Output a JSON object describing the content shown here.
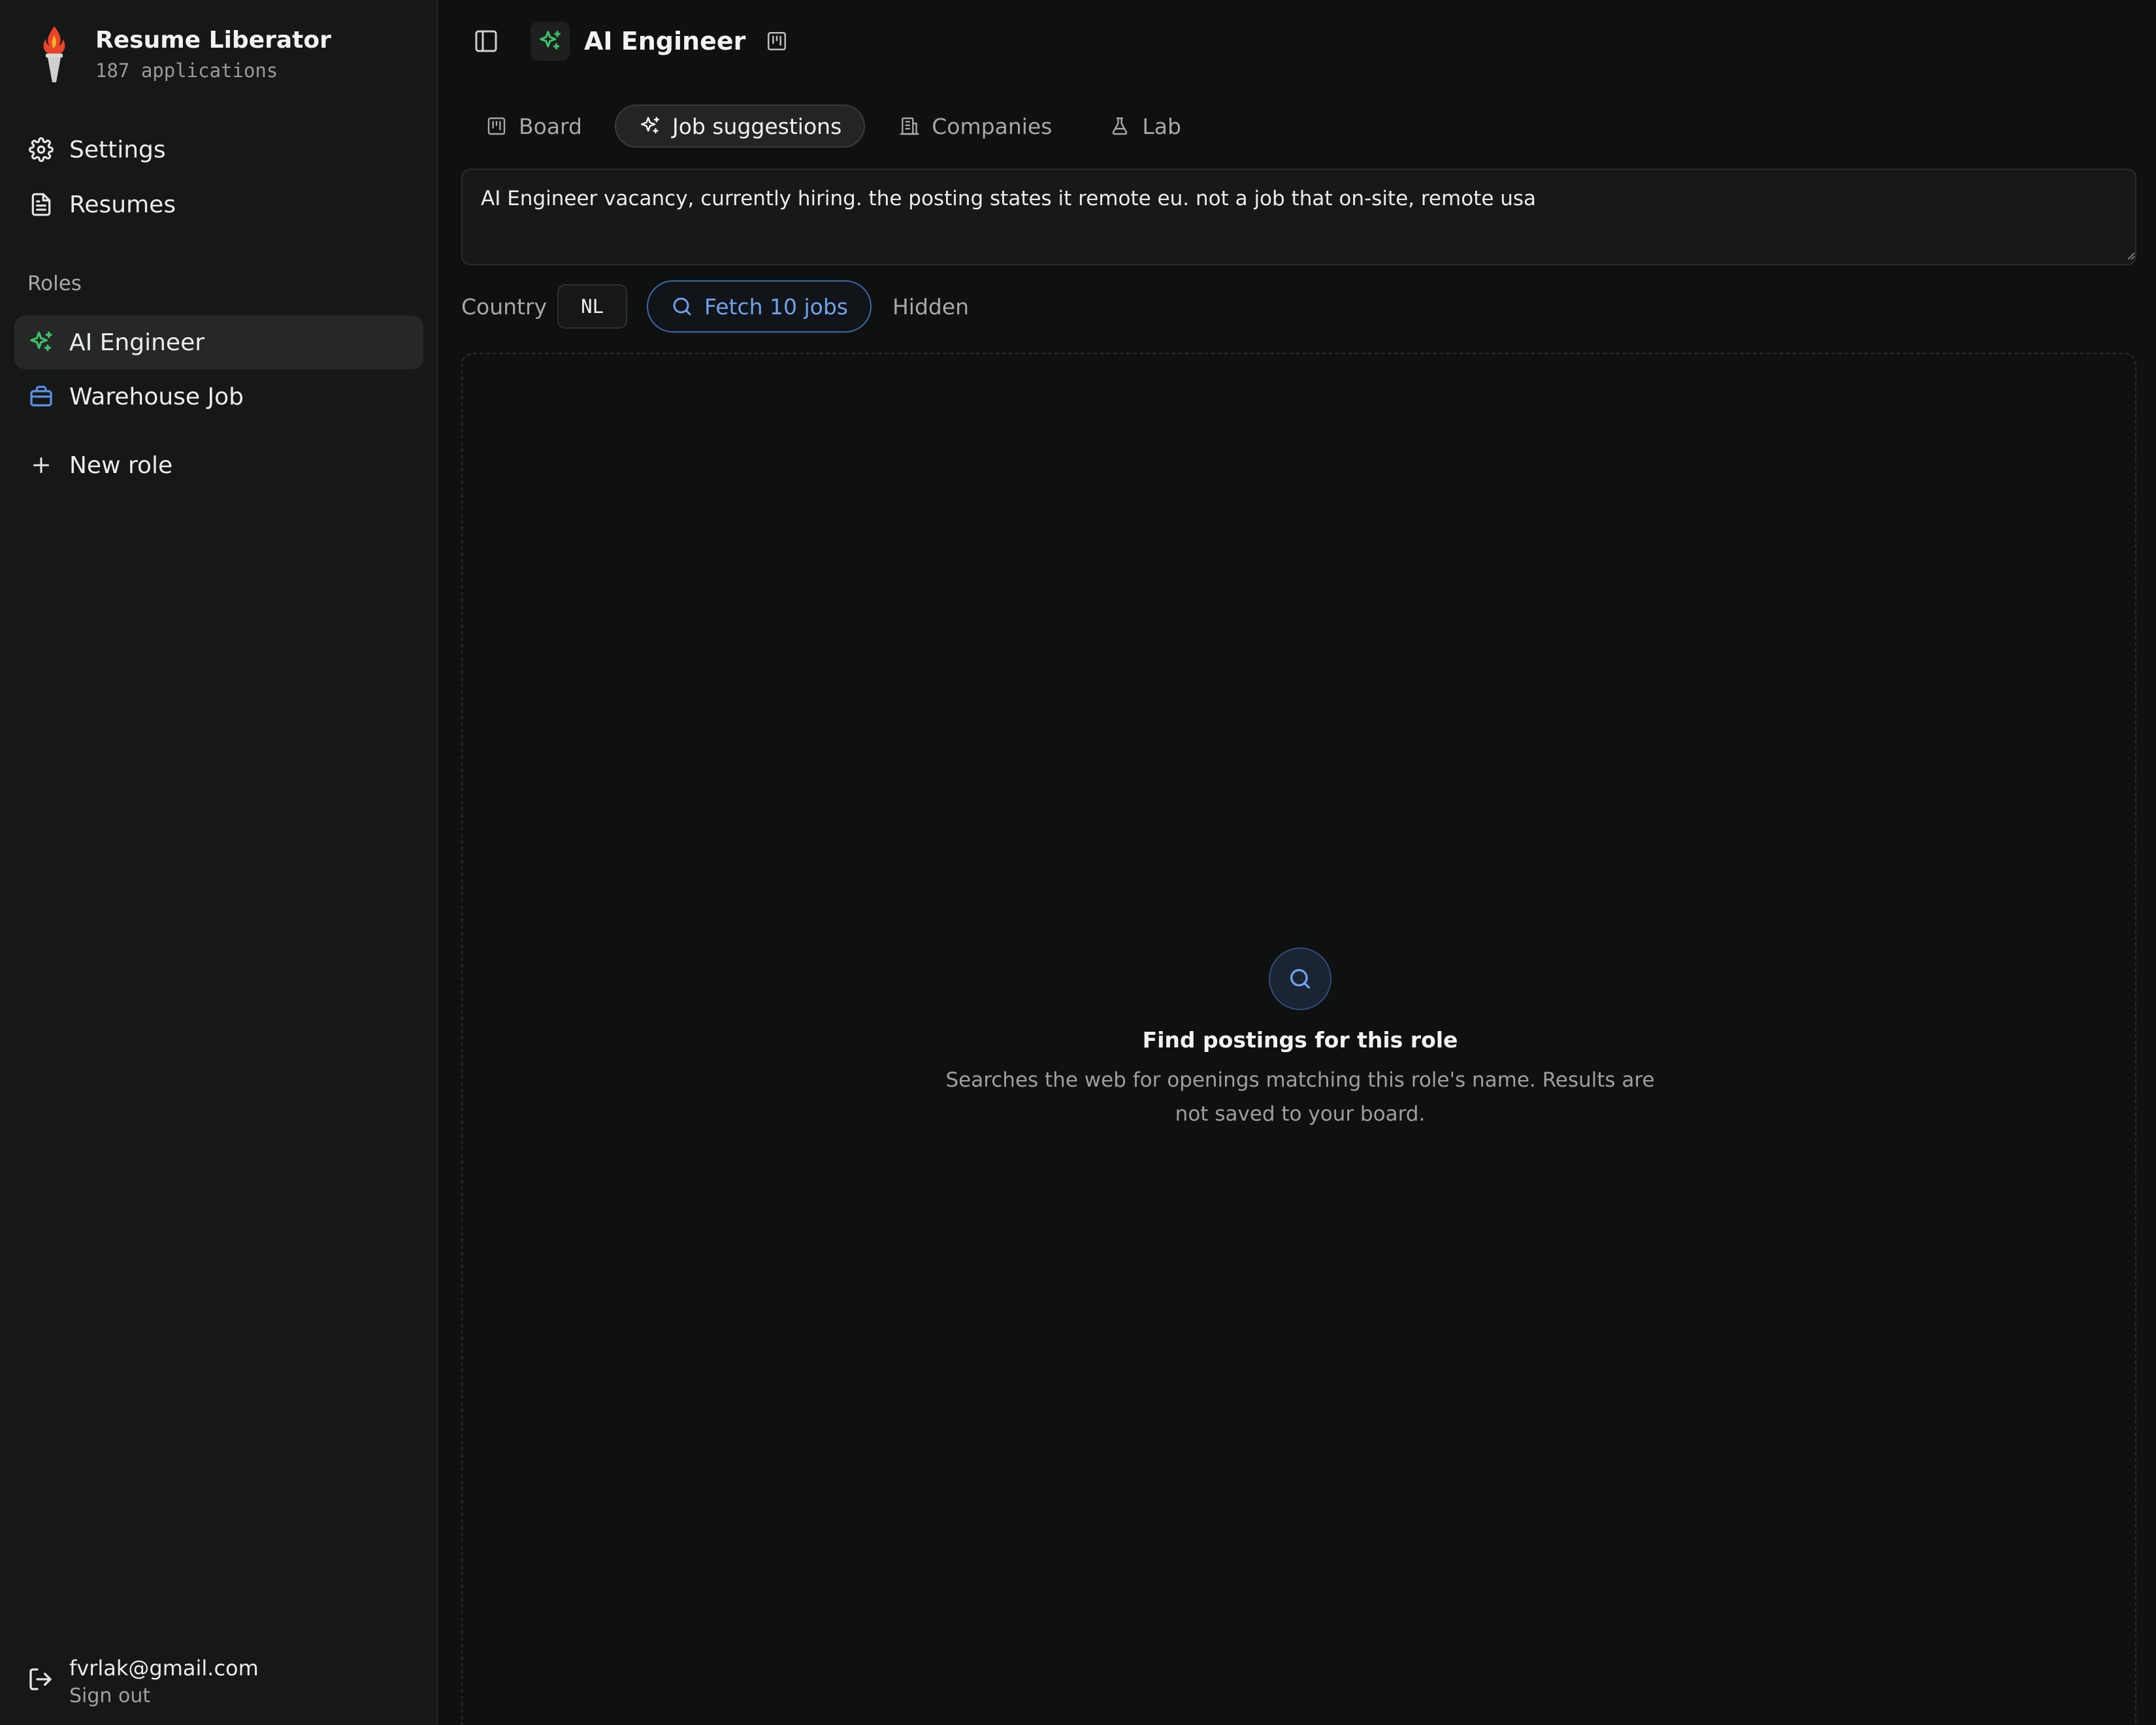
{
  "brand": {
    "title": "Resume Liberator",
    "subtitle": "187 applications"
  },
  "sidebar": {
    "settings_label": "Settings",
    "resumes_label": "Resumes",
    "roles_heading": "Roles",
    "roles": [
      {
        "label": "AI Engineer",
        "icon": "sparkles-icon",
        "active": true
      },
      {
        "label": "Warehouse Job",
        "icon": "briefcase-icon",
        "active": false
      }
    ],
    "new_role_label": "New role"
  },
  "account": {
    "email": "fvrlak@gmail.com",
    "signout_label": "Sign out"
  },
  "header": {
    "title": "AI Engineer"
  },
  "tabs": [
    {
      "label": "Board",
      "icon": "board-icon"
    },
    {
      "label": "Job suggestions",
      "icon": "sparkles-icon",
      "active": true
    },
    {
      "label": "Companies",
      "icon": "building-icon"
    },
    {
      "label": "Lab",
      "icon": "flask-icon"
    }
  ],
  "prompt": {
    "value": "AI Engineer vacancy, currently hiring. the posting states it remote eu. not a job that on-site, remote usa"
  },
  "controls": {
    "country_label": "Country",
    "country_value": "NL",
    "fetch_label": "Fetch 10 jobs",
    "hidden_label": "Hidden"
  },
  "empty_state": {
    "title": "Find postings for this role",
    "description": "Searches the web for openings matching this role's name. Results are not saved to your board."
  },
  "colors": {
    "accent_green": "#3fbf6a",
    "accent_blue": "#6fa3ea",
    "briefcase_blue": "#5b8fe0",
    "background": "#0f1010",
    "sidebar": "#161717"
  }
}
